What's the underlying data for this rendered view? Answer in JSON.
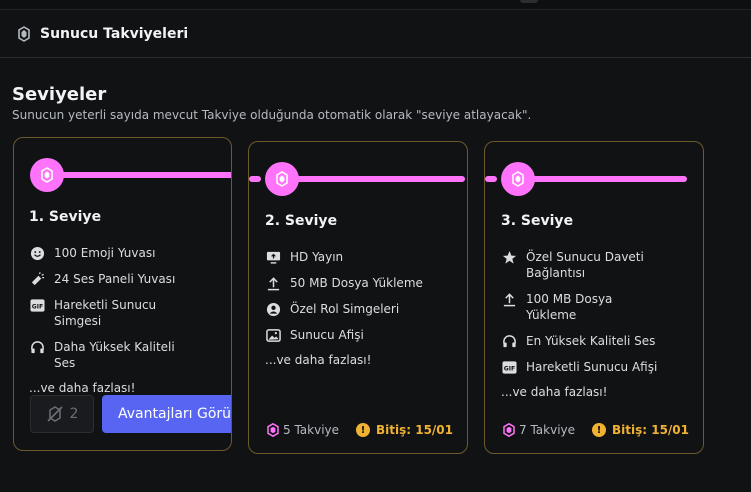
{
  "header": {
    "title": "Sunucu Takviyeleri",
    "icon": "boost-gem-icon"
  },
  "section": {
    "title": "Seviyeler",
    "subtitle": "Sunucun yeterli sayıda mevcut Takviye olduğunda otomatik olarak \"seviye atlayacak\"."
  },
  "colors": {
    "accent_pink": "#ff73fa",
    "blurple": "#5865f2",
    "warning": "#f0b232",
    "card_border": "#6b5a2c"
  },
  "tiers": [
    {
      "title": "1. Seviye",
      "perks": [
        {
          "icon": "emoji-icon",
          "label": "100 Emoji Yuvası"
        },
        {
          "icon": "soundboard-icon",
          "label": "24 Ses Paneli Yuvası"
        },
        {
          "icon": "gif-icon",
          "label": "Hareketli Sunucu Simgesi"
        },
        {
          "icon": "headphones-icon",
          "label": "Daha Yüksek Kaliteli Ses"
        }
      ],
      "more": "...ve daha fazlası!",
      "locked_count": "2",
      "benefits_button": "Avantajları Görü"
    },
    {
      "title": "2. Seviye",
      "perks": [
        {
          "icon": "screen-share-icon",
          "label": "HD Yayın"
        },
        {
          "icon": "upload-icon",
          "label": "50 MB Dosya Yükleme"
        },
        {
          "icon": "role-icon",
          "label": "Özel Rol Simgeleri"
        },
        {
          "icon": "image-icon",
          "label": "Sunucu Afişi"
        }
      ],
      "more": "...ve daha fazlası!",
      "boosts": "5 Takviye",
      "expiry": "Bitiş: 15/01"
    },
    {
      "title": "3. Seviye",
      "perks": [
        {
          "icon": "star-icon",
          "label": "Özel Sunucu Daveti Bağlantısı"
        },
        {
          "icon": "upload-icon",
          "label": "100 MB Dosya Yükleme"
        },
        {
          "icon": "headphones-icon",
          "label": "En Yüksek Kaliteli Ses"
        },
        {
          "icon": "gif-icon",
          "label": "Hareketli Sunucu Afişi"
        }
      ],
      "more": "...ve daha fazlası!",
      "boosts": "7 Takviye",
      "expiry": "Bitiş: 15/01"
    }
  ]
}
